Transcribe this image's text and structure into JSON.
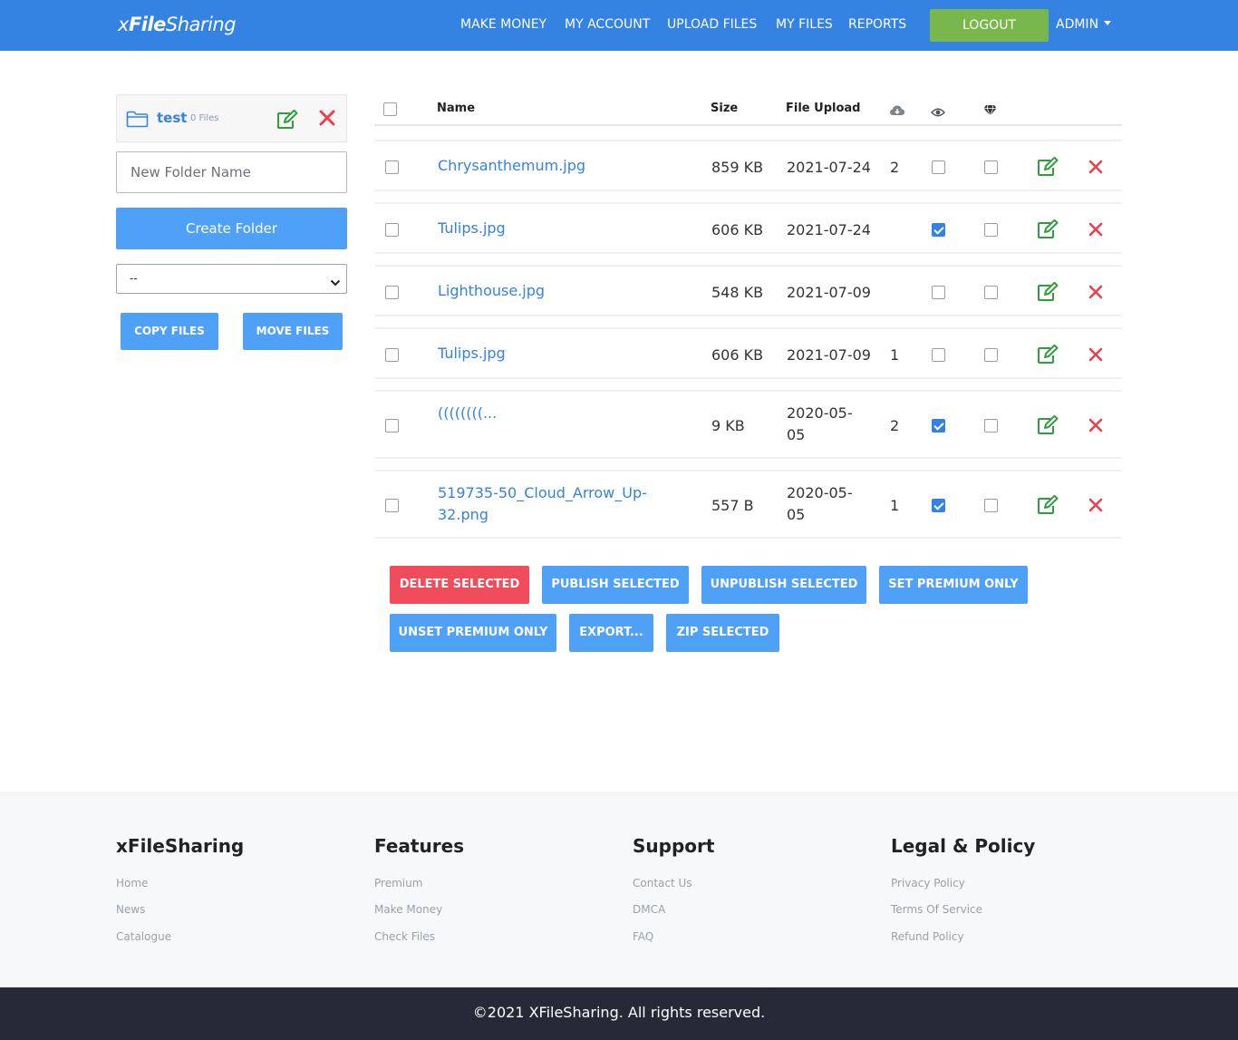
{
  "header": {
    "logo_prefix": "x",
    "logo_bold": "File",
    "logo_suffix": "Sharing",
    "nav": [
      "MAKE MONEY",
      "MY ACCOUNT",
      "UPLOAD FILES",
      "MY FILES",
      "REPORTS"
    ],
    "logout": "LOGOUT",
    "admin": "ADMIN"
  },
  "sidebar": {
    "folder_name": "test",
    "folder_count": "0 Files",
    "new_folder_placeholder": "New Folder Name",
    "create_folder": "Create Folder",
    "select_value": "--",
    "copy_files": "COPY FILES",
    "move_files": "MOVE FILES"
  },
  "table": {
    "headers": {
      "name": "Name",
      "size": "Size",
      "upload": "File Upload"
    },
    "rows": [
      {
        "name": "Chrysanthemum.jpg",
        "size": "859 KB",
        "date": "2021-07-24",
        "downloads": "2",
        "public": false,
        "premium": false
      },
      {
        "name": "Tulips.jpg",
        "size": "606 KB",
        "date": "2021-07-24",
        "downloads": "",
        "public": true,
        "premium": false
      },
      {
        "name": "Lighthouse.jpg",
        "size": "548 KB",
        "date": "2021-07-09",
        "downloads": "",
        "public": false,
        "premium": false
      },
      {
        "name": "Tulips.jpg",
        "size": "606 KB",
        "date": "2021-07-09",
        "downloads": "1",
        "public": false,
        "premium": false
      },
      {
        "name": "((((((((...",
        "size": "9 KB",
        "date": "2020-05-05",
        "downloads": "2",
        "public": true,
        "premium": false
      },
      {
        "name": "519735-50_Cloud_Arrow_Up-32.png",
        "size": "557 B",
        "date": "2020-05-05",
        "downloads": "1",
        "public": true,
        "premium": false
      }
    ]
  },
  "actions": {
    "delete_selected": "DELETE SELECTED",
    "publish_selected": "PUBLISH SELECTED",
    "unpublish_selected": "UNPUBLISH SELECTED",
    "set_premium_only": "SET PREMIUM ONLY",
    "unset_premium_only": "UNSET PREMIUM ONLY",
    "export": "EXPORT...",
    "zip_selected": "ZIP SELECTED"
  },
  "footer": {
    "columns": [
      {
        "title": "xFileSharing",
        "links": [
          "Home",
          "News",
          "Catalogue"
        ]
      },
      {
        "title": "Features",
        "links": [
          "Premium",
          "Make Money",
          "Check Files"
        ]
      },
      {
        "title": "Support",
        "links": [
          "Contact Us",
          "DMCA",
          "FAQ"
        ]
      },
      {
        "title": "Legal & Policy",
        "links": [
          "Privacy Policy",
          "Terms Of Service",
          "Refund Policy"
        ]
      }
    ],
    "copyright": "©2021 XFileSharing. All rights reserved."
  },
  "colors": {
    "primary": "#3482e1",
    "button": "#4fa0f7",
    "success": "#79b74c",
    "danger": "#f04c5c",
    "edit_icon": "#2e9e3a",
    "footer_dark": "#262a36"
  },
  "icons": {
    "folder": "folder-icon",
    "edit": "edit-icon",
    "delete": "close-icon",
    "downloads_col": "cloud-download-icon",
    "public_col": "eye-icon",
    "premium_col": "diamond-icon"
  }
}
